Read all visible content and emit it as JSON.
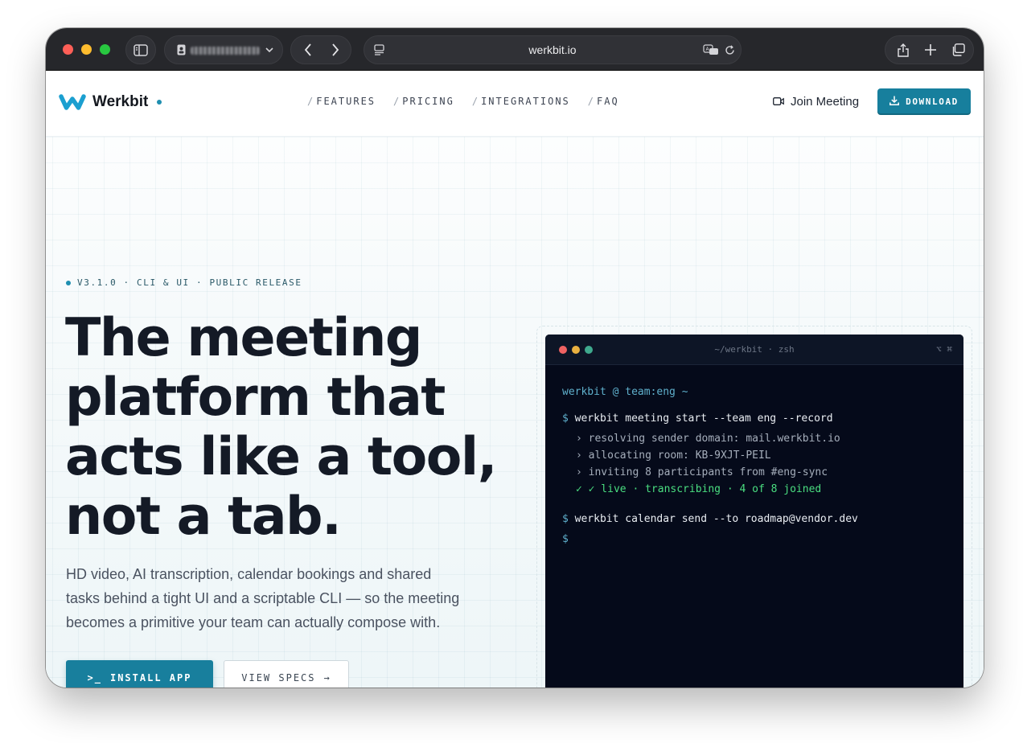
{
  "browser": {
    "url": "werkbit.io",
    "profile_label": ""
  },
  "colors": {
    "brand": "#177f9d",
    "accent_dot": "#1f8fb0",
    "terminal_bg": "#050a1a",
    "terminal_prompt": "#5fb0cc",
    "terminal_ok": "#4ade80"
  },
  "nav": {
    "logo_text": "Werkbit",
    "links": [
      {
        "slash": "/",
        "label": "FEATURES"
      },
      {
        "slash": "/",
        "label": "PRICING"
      },
      {
        "slash": "/",
        "label": "INTEGRATIONS"
      },
      {
        "slash": "/",
        "label": "FAQ"
      }
    ],
    "join_label": "Join Meeting",
    "download_label": "DOWNLOAD"
  },
  "hero": {
    "release": "V3.1.0 · CLI & UI · PUBLIC RELEASE",
    "headline": [
      "The meeting",
      "platform that",
      "acts like a tool,",
      "not a tab."
    ],
    "subtext": [
      "HD video, AI transcription, calendar bookings and shared",
      "tasks behind a tight UI and a scriptable CLI — so the meeting",
      "becomes a primitive your team can actually compose with."
    ],
    "install_label": "INSTALL APP",
    "install_glyph": ">_",
    "specs_label": "VIEW SPECS",
    "specs_glyph": "→"
  },
  "terminal": {
    "title": "~/werkbit · zsh",
    "keys": "⌥ ⌘",
    "context": "werkbit @ team:eng ~",
    "lines": [
      {
        "kind": "cmd",
        "prompt": "$",
        "text": "werkbit meeting start --team eng --record"
      },
      {
        "kind": "sub",
        "text": "› resolving sender domain: mail.werkbit.io"
      },
      {
        "kind": "sub",
        "text": "› allocating room: KB-9XJT-PEIL"
      },
      {
        "kind": "sub",
        "text": "› inviting 8 participants from #eng-sync"
      },
      {
        "kind": "ok",
        "text": "✓ ✓ live · transcribing · 4 of 8 joined"
      },
      {
        "kind": "cmd",
        "prompt": "$",
        "text": "werkbit calendar send --to roadmap@vendor.dev"
      },
      {
        "kind": "cmd",
        "prompt": "$",
        "text": ""
      }
    ]
  }
}
